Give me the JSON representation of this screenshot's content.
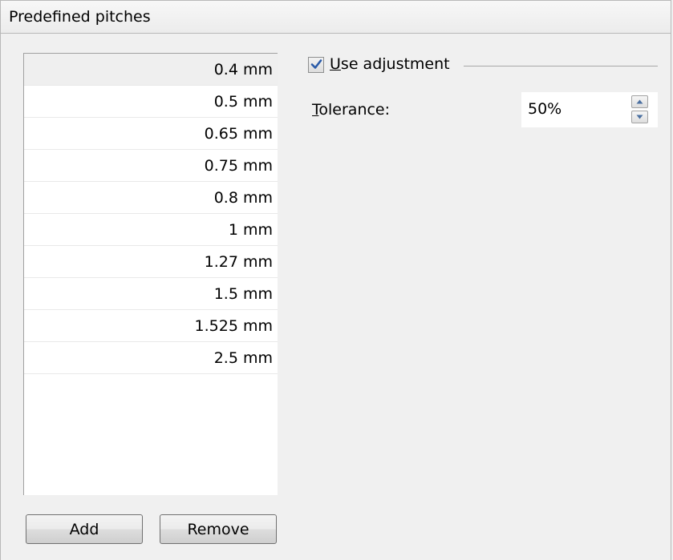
{
  "header": {
    "title": "Predefined pitches"
  },
  "pitches": {
    "items": [
      "0.4 mm",
      "0.5 mm",
      "0.65 mm",
      "0.75 mm",
      "0.8 mm",
      "1 mm",
      "1.27 mm",
      "1.5 mm",
      "1.525 mm",
      "2.5 mm"
    ],
    "selected": "0.4 mm"
  },
  "buttons": {
    "add_label": "Add",
    "remove_label": "Remove"
  },
  "adjustment": {
    "checkbox_label": "Use adjustment",
    "checked": true,
    "tolerance_label": "Tolerance:",
    "tolerance_value": "50%"
  },
  "icons": {
    "checkmark": "checkmark-icon",
    "spin_up": "spin-up-arrow-icon",
    "spin_down": "spin-down-arrow-icon"
  },
  "colors": {
    "checkmark": "#2a5ba8",
    "selected_row": "#efefef"
  }
}
